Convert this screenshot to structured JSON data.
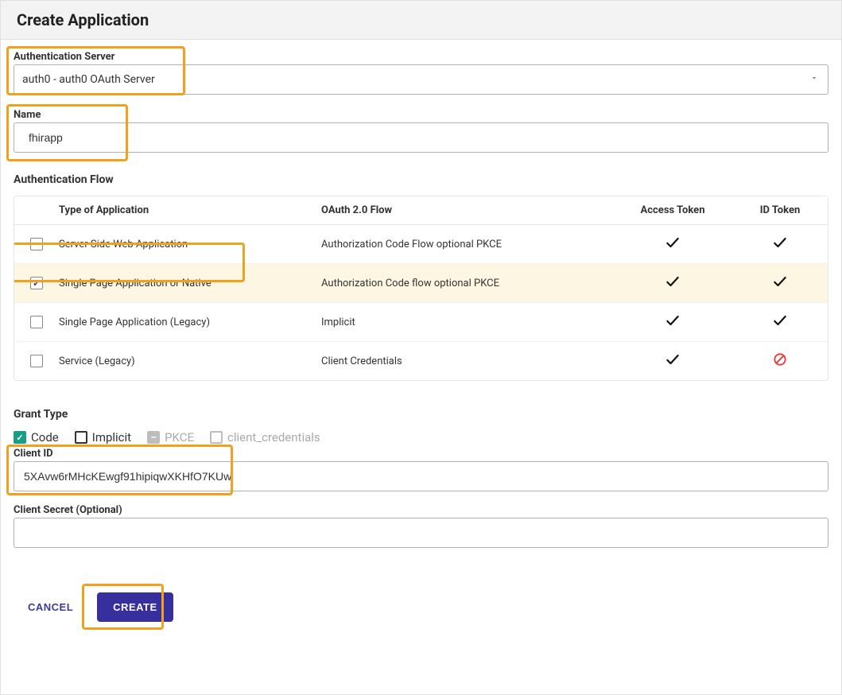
{
  "header": {
    "title": "Create Application"
  },
  "auth_server": {
    "label": "Authentication Server",
    "value": "auth0 - auth0 OAuth Server"
  },
  "name": {
    "label": "Name",
    "value": "fhirapp"
  },
  "flow": {
    "section_title": "Authentication Flow",
    "columns": {
      "type": "Type of Application",
      "flow": "OAuth 2.0 Flow",
      "access_token": "Access Token",
      "id_token": "ID Token"
    },
    "rows": [
      {
        "checked": false,
        "type": "Server Side Web Application",
        "flow": "Authorization Code Flow optional PKCE",
        "access_token": "yes",
        "id_token": "yes"
      },
      {
        "checked": true,
        "type": "Single Page Application or Native",
        "flow": "Authorization Code flow optional PKCE",
        "access_token": "yes",
        "id_token": "yes"
      },
      {
        "checked": false,
        "type": "Single Page Application (Legacy)",
        "flow": "Implicit",
        "access_token": "yes",
        "id_token": "yes"
      },
      {
        "checked": false,
        "type": "Service (Legacy)",
        "flow": "Client Credentials",
        "access_token": "yes",
        "id_token": "no"
      }
    ]
  },
  "grant": {
    "section_title": "Grant Type",
    "items": [
      {
        "label": "Code",
        "state": "checked"
      },
      {
        "label": "Implicit",
        "state": "unchecked"
      },
      {
        "label": "PKCE",
        "state": "indeterminate-disabled"
      },
      {
        "label": "client_credentials",
        "state": "unchecked-disabled"
      }
    ]
  },
  "client_id": {
    "label": "Client ID",
    "value": "5XAvw6rMHcKEwgf91hipiqwXKHfO7KUw"
  },
  "client_secret": {
    "label": "Client Secret (Optional)",
    "value": ""
  },
  "actions": {
    "cancel": "CANCEL",
    "create": "CREATE"
  },
  "colors": {
    "highlight": "#f0a11f",
    "primary": "#362f9d",
    "teal": "#179e87",
    "text": "#333333"
  }
}
